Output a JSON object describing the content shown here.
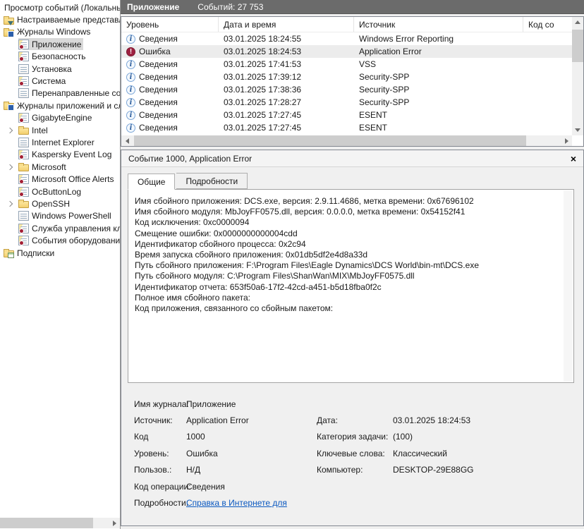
{
  "sidebar": {
    "root": "Просмотр событий (Локальнь",
    "items": [
      {
        "label": "Настраиваемые представле"
      },
      {
        "label": "Журналы Windows"
      },
      {
        "label": "Приложение"
      },
      {
        "label": "Безопасность"
      },
      {
        "label": "Установка"
      },
      {
        "label": "Система"
      },
      {
        "label": "Перенаправленные соб"
      },
      {
        "label": "Журналы приложений и сл"
      },
      {
        "label": "GigabyteEngine"
      },
      {
        "label": "Intel"
      },
      {
        "label": "Internet Explorer"
      },
      {
        "label": "Kaspersky Event Log"
      },
      {
        "label": "Microsoft"
      },
      {
        "label": "Microsoft Office Alerts"
      },
      {
        "label": "OcButtonLog"
      },
      {
        "label": "OpenSSH"
      },
      {
        "label": "Windows PowerShell"
      },
      {
        "label": "Служба управления клю"
      },
      {
        "label": "События оборудования"
      },
      {
        "label": "Подписки"
      }
    ]
  },
  "titlebar": {
    "title": "Приложение",
    "count": "Событий: 27 753"
  },
  "event_list": {
    "columns": {
      "level": "Уровень",
      "datetime": "Дата и время",
      "source": "Источник",
      "code": "Код со"
    },
    "rows": [
      {
        "level": "Сведения",
        "datetime": "03.01.2025 18:24:55",
        "source": "Windows Error Reporting"
      },
      {
        "level": "Ошибка",
        "datetime": "03.01.2025 18:24:53",
        "source": "Application Error"
      },
      {
        "level": "Сведения",
        "datetime": "03.01.2025 17:41:53",
        "source": "VSS"
      },
      {
        "level": "Сведения",
        "datetime": "03.01.2025 17:39:12",
        "source": "Security-SPP"
      },
      {
        "level": "Сведения",
        "datetime": "03.01.2025 17:38:36",
        "source": "Security-SPP"
      },
      {
        "level": "Сведения",
        "datetime": "03.01.2025 17:28:27",
        "source": "Security-SPP"
      },
      {
        "level": "Сведения",
        "datetime": "03.01.2025 17:27:45",
        "source": "ESENT"
      },
      {
        "level": "Сведения",
        "datetime": "03.01.2025 17:27:45",
        "source": "ESENT"
      }
    ]
  },
  "details": {
    "header": "Событие 1000, Application Error",
    "close": "×",
    "tabs": {
      "general": "Общие",
      "details": "Подробности"
    },
    "description_lines": [
      "Имя сбойного приложения: DCS.exe, версия: 2.9.11.4686, метка времени: 0x67696102",
      "Имя сбойного модуля: MbJoyFF0575.dll, версия: 0.0.0.0, метка времени: 0x54152f41",
      "Код исключения: 0xc0000094",
      "Смещение ошибки: 0x0000000000004cdd",
      "Идентификатор сбойного процесса: 0x2c94",
      "Время запуска сбойного приложения: 0x01db5df2e4d8a33d",
      "Путь сбойного приложения: F:\\Program Files\\Eagle Dynamics\\DCS World\\bin-mt\\DCS.exe",
      "Путь сбойного модуля: C:\\Program Files\\ShanWan\\MIX\\MbJoyFF0575.dll",
      "Идентификатор отчета: 653f50a6-17f2-42cd-a451-b5d18fba0f2c",
      "Полное имя сбойного пакета:",
      "Код приложения, связанного со сбойным пакетом:"
    ],
    "fields": [
      {
        "ll": "Имя журнала:",
        "lv": "Приложение",
        "rl": "",
        "rv": ""
      },
      {
        "ll": "Источник:",
        "lv": "Application Error",
        "rl": "Дата:",
        "rv": "03.01.2025 18:24:53"
      },
      {
        "ll": "Код",
        "lv": "1000",
        "rl": "Категория задачи:",
        "rv": "(100)"
      },
      {
        "ll": "Уровень:",
        "lv": "Ошибка",
        "rl": "Ключевые слова:",
        "rv": "Классический"
      },
      {
        "ll": "Пользов.:",
        "lv": "Н/Д",
        "rl": "Компьютер:",
        "rv": "DESKTOP-29E88GG"
      },
      {
        "ll": "Код операции:",
        "lv": "Сведения",
        "rl": "",
        "rv": ""
      }
    ],
    "more_info_label": "Подробности:",
    "more_info_link": "Справка в Интернете для"
  }
}
